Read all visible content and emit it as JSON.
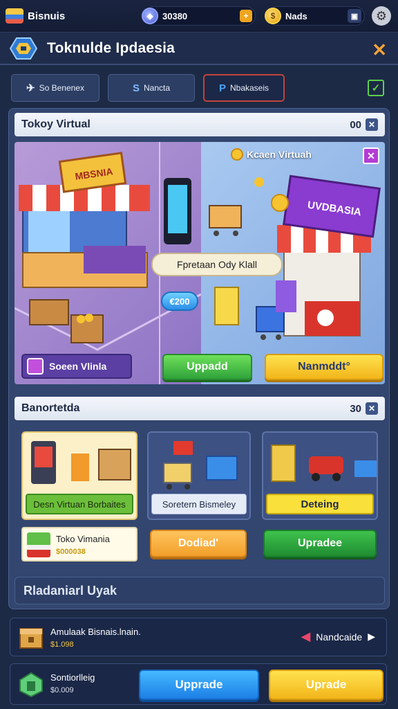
{
  "topbar": {
    "app_name": "Bisnuis",
    "gems": "30380",
    "gold": "Nads"
  },
  "header": {
    "title": "Toknulde Ipdaesia"
  },
  "tabs": [
    {
      "label": "So Benenex",
      "icon": "briefcase-icon"
    },
    {
      "label": "Nancta",
      "icon": "s-coin-icon"
    },
    {
      "label": "Nbakaseis",
      "icon": "p-icon"
    }
  ],
  "section1": {
    "title": "Tokoy Virtual",
    "count": "00",
    "right_scene_title": "Kcaen Virtuah",
    "left_sign": "MBSNIA",
    "right_sign": "UVDBASIA",
    "info_pill": "Fpretaan Ody Klall",
    "price_pill": "€200",
    "store_button": "Soeen Vlinla",
    "upgrade_button": "Uppadd",
    "yellow_button": "Nanmddt°"
  },
  "section2": {
    "title": "Banortetda",
    "count": "30",
    "cards": [
      {
        "label": "Desn Virtuan Borbaites"
      },
      {
        "label": "Soretern Bismeley"
      },
      {
        "label": "Deteing"
      }
    ],
    "toko": {
      "title": "Toko Vimania",
      "value": "$000038"
    },
    "buttons": [
      "Dodiad'",
      "Upradee"
    ]
  },
  "banner": {
    "label": "Rladaniarl Uyak"
  },
  "rows": [
    {
      "title": "Amulaak Bisnais.lnain.",
      "value": "$1.098",
      "action": "Nandcaide"
    },
    {
      "title": "Sontiorlleig",
      "value": "$0.009",
      "button1": "Upprade",
      "button2": "Uprade"
    }
  ],
  "colors": {
    "accent_orange": "#f2a33a",
    "green": "#2fa33a",
    "yellow": "#f2b51a",
    "blue": "#1c7fe6",
    "panel": "#33466f"
  }
}
